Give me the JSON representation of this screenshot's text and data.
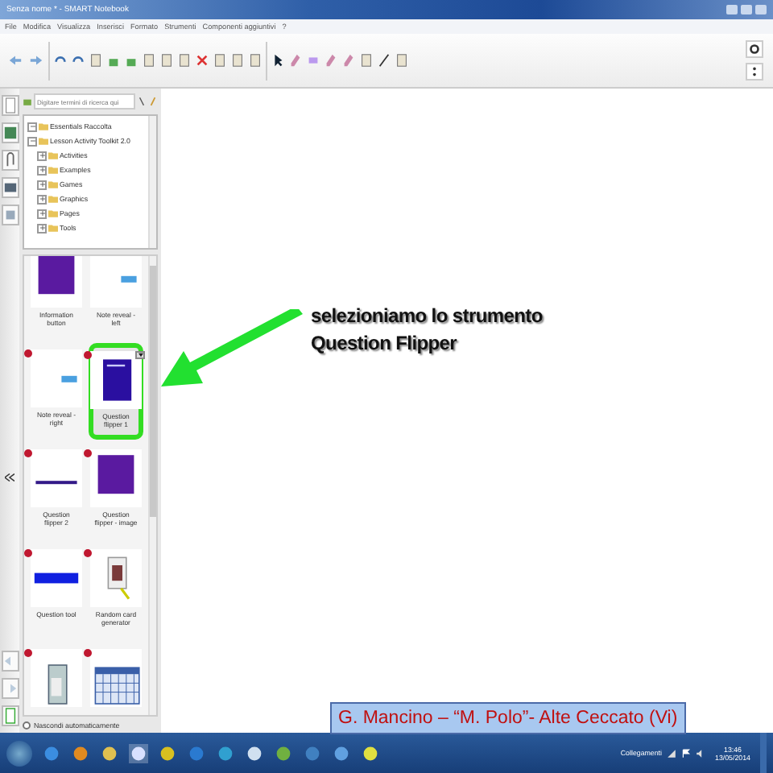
{
  "window": {
    "title": "Senza nome * - SMART Notebook"
  },
  "menu": [
    "File",
    "Modifica",
    "Visualizza",
    "Inserisci",
    "Formato",
    "Strumenti",
    "Componenti aggiuntivi",
    "?"
  ],
  "gallery": {
    "search": {
      "placeholder": "Digitare termini di ricerca qui"
    },
    "tree": [
      {
        "label": "Essentials Raccolta"
      },
      {
        "label": "Lesson Activity Toolkit 2.0",
        "children": [
          {
            "label": "Activities"
          },
          {
            "label": "Examples"
          },
          {
            "label": "Games"
          },
          {
            "label": "Graphics"
          },
          {
            "label": "Pages"
          },
          {
            "label": "Tools"
          }
        ]
      }
    ],
    "items": [
      {
        "label": "Information button",
        "kind": "purple-block",
        "marked": false,
        "selected": false
      },
      {
        "label": "Note reveal - left",
        "kind": "tag",
        "marked": false,
        "selected": false
      },
      {
        "label": "Note reveal - right",
        "kind": "tag",
        "marked": true,
        "selected": false
      },
      {
        "label": "Question flipper 1",
        "kind": "purple-card",
        "marked": true,
        "selected": true
      },
      {
        "label": "Question flipper 2",
        "kind": "line",
        "marked": true,
        "selected": false
      },
      {
        "label": "Question flipper - image",
        "kind": "purple-block",
        "marked": true,
        "selected": false
      },
      {
        "label": "Question tool",
        "kind": "bar",
        "marked": true,
        "selected": false
      },
      {
        "label": "Random card generator",
        "kind": "card",
        "marked": true,
        "selected": false
      },
      {
        "kind": "calculator",
        "marked": true,
        "selected": false
      },
      {
        "kind": "table",
        "marked": true,
        "selected": false
      }
    ],
    "autohide": {
      "label": "Nascondi automaticamente",
      "checked": false
    }
  },
  "annotation": {
    "lines": [
      "selezioniamo lo strumento",
      "Question Flipper"
    ]
  },
  "caption": "G. Mancino – “M. Polo”- Alte Ceccato (Vi)",
  "taskbar": {
    "tray_label": "Collegamenti",
    "time": "13:46",
    "date": "13/05/2014"
  }
}
